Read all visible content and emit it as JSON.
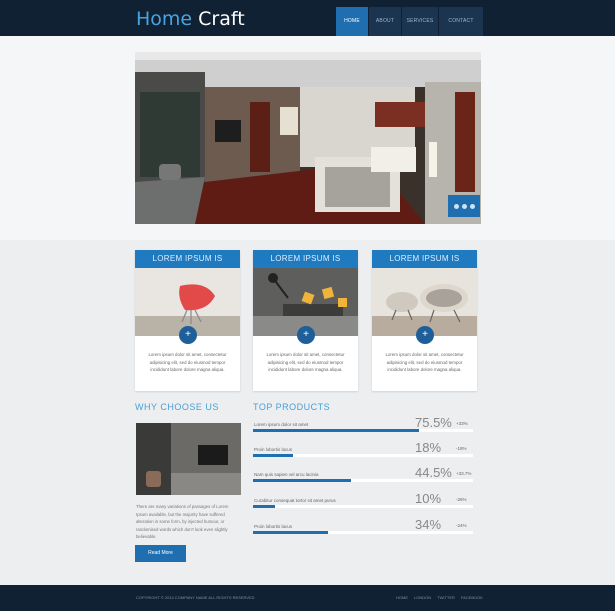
{
  "header": {
    "logo_part1": "Home",
    "logo_part2": "Craft",
    "nav": [
      {
        "label": "HOME"
      },
      {
        "label": "ABOUT"
      },
      {
        "label": "SERVICES"
      },
      {
        "label": "CONTACT"
      }
    ]
  },
  "hero": {
    "slide_count": 3
  },
  "cards": [
    {
      "title": "LOREM IPSUM IS",
      "text": "Lorem ipsum dolor sit amet, consectetur adipisicing elit, sed do eiusmod tempor incididunt labore dolore magna aliqua."
    },
    {
      "title": "LOREM IPSUM IS",
      "text": "Lorem ipsum dolor sit amet, consectetur adipisicing elit, sed do eiusmod tempor incididunt labore dolore magna aliqua."
    },
    {
      "title": "LOREM IPSUM IS",
      "text": "Lorem ipsum dolor sit amet, consectetur adipisicing elit, sed do eiusmod tempor incididunt labore dolore magna aliqua."
    }
  ],
  "why": {
    "title": "WHY CHOOSE US",
    "text": "There are many variations of passages of Lorem Ipsum available, but the majority have suffered alteration in some form, by injected humour, or randomised words which don't look even slightly believable.",
    "button": "Read More"
  },
  "products": {
    "title": "TOP PRODUCTS",
    "items": [
      {
        "label": "Lorem ipsum dolor sit amet",
        "pct": "75.5%",
        "delta": "+33%",
        "level": 0.755
      },
      {
        "label": "Proin lobortis lacus",
        "pct": "18%",
        "delta": "-18%",
        "level": 0.18
      },
      {
        "label": "Nam quis sapien vel arcu lacinia",
        "pct": "44.5%",
        "delta": "+33.7%",
        "level": 0.445
      },
      {
        "label": "Curabitur consequat tortor sit amet purus",
        "pct": "10%",
        "delta": "-26%",
        "level": 0.1
      },
      {
        "label": "Proin lobortis lacus",
        "pct": "34%",
        "delta": "-24%",
        "level": 0.34
      }
    ]
  },
  "footer": {
    "copyright": "COPYRIGHT © 2014 COMPANY NAME ALL RIGHTS RESERVED",
    "nav": [
      "HOME",
      "LONDON",
      "TWITTER",
      "FACEBOOK"
    ]
  },
  "colors": {
    "header_bg": "#0f2133",
    "accent": "#1f6fb0",
    "title_blue": "#4a9fd6"
  }
}
